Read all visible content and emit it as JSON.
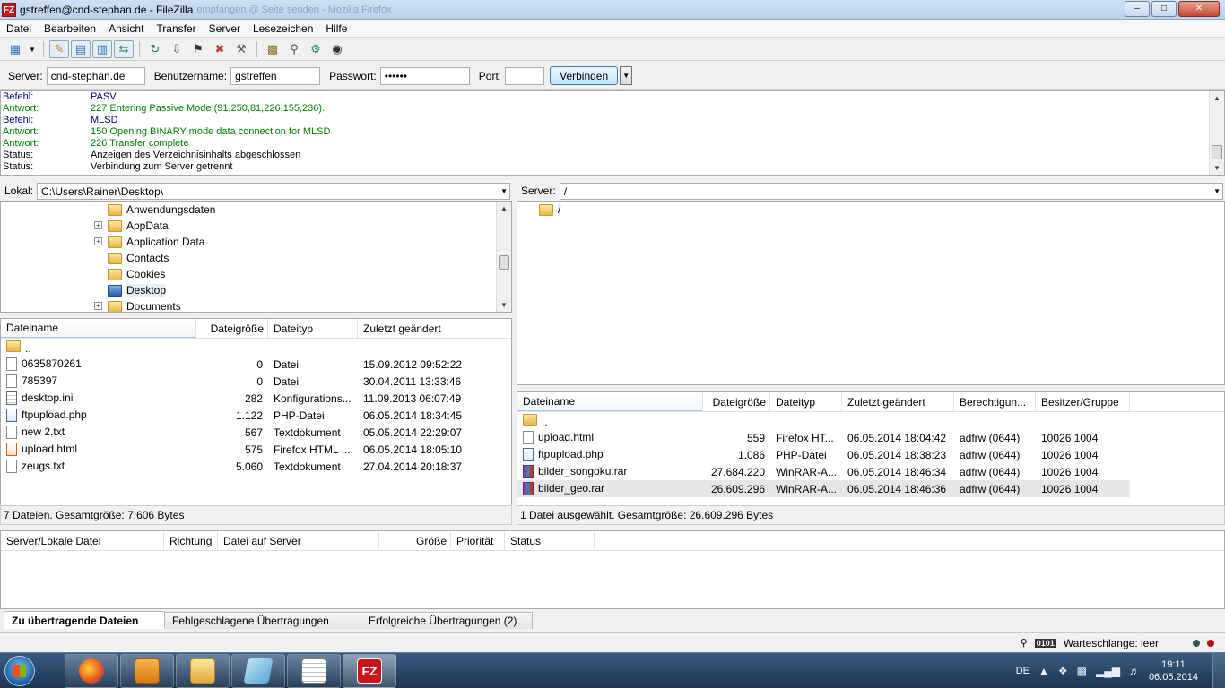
{
  "window": {
    "title": "gstreffen@cnd-stephan.de - FileZilla",
    "ghost_title": "empfangen @ Seite senden - Mozilla Firefox",
    "app_icon": "FZ"
  },
  "menu": [
    "Datei",
    "Bearbeiten",
    "Ansicht",
    "Transfer",
    "Server",
    "Lesezeichen",
    "Hilfe"
  ],
  "quickconnect": {
    "server_label": "Server:",
    "server_value": "cnd-stephan.de",
    "user_label": "Benutzername:",
    "user_value": "gstreffen",
    "password_label": "Passwort:",
    "password_value": "••••••",
    "port_label": "Port:",
    "port_value": "",
    "connect_label": "Verbinden"
  },
  "log": [
    {
      "type": "Befehl:",
      "text": "PASV",
      "kind": "cmd"
    },
    {
      "type": "Antwort:",
      "text": "227 Entering Passive Mode (91,250,81,226,155,236).",
      "kind": "resp"
    },
    {
      "type": "Befehl:",
      "text": "MLSD",
      "kind": "cmd"
    },
    {
      "type": "Antwort:",
      "text": "150 Opening BINARY mode data connection for MLSD",
      "kind": "resp"
    },
    {
      "type": "Antwort:",
      "text": "226 Transfer complete",
      "kind": "resp"
    },
    {
      "type": "Status:",
      "text": "Anzeigen des Verzeichnisinhalts abgeschlossen",
      "kind": "status"
    },
    {
      "type": "Status:",
      "text": "Verbindung zum Server getrennt",
      "kind": "status"
    }
  ],
  "local": {
    "path_label": "Lokal:",
    "path_value": "C:\\Users\\Rainer\\Desktop\\",
    "tree": [
      {
        "label": "Anwendungsdaten",
        "expandable": false,
        "icon": "folder-icon"
      },
      {
        "label": "AppData",
        "expandable": true,
        "icon": "folder-icon"
      },
      {
        "label": "Application Data",
        "expandable": true,
        "icon": "folder-icon"
      },
      {
        "label": "Contacts",
        "expandable": false,
        "icon": "contacts-folder-icon"
      },
      {
        "label": "Cookies",
        "expandable": false,
        "icon": "folder-icon"
      },
      {
        "label": "Desktop",
        "expandable": false,
        "icon": "desktop-folder-icon",
        "selected": true
      },
      {
        "label": "Documents",
        "expandable": true,
        "icon": "documents-folder-icon"
      }
    ],
    "columns": [
      "Dateiname",
      "Dateigröße",
      "Dateityp",
      "Zuletzt geändert"
    ],
    "files": [
      {
        "name": "..",
        "size": "",
        "type": "",
        "modified": "",
        "icon": "folder-icon"
      },
      {
        "name": "0635870261",
        "size": "0",
        "type": "Datei",
        "modified": "15.09.2012 09:52:22",
        "icon": "file-icon"
      },
      {
        "name": "785397",
        "size": "0",
        "type": "Datei",
        "modified": "30.04.2011 13:33:46",
        "icon": "file-icon"
      },
      {
        "name": "desktop.ini",
        "size": "282",
        "type": "Konfigurations...",
        "modified": "11.09.2013 06:07:49",
        "icon": "ini-file-icon"
      },
      {
        "name": "ftpupload.php",
        "size": "1.122",
        "type": "PHP-Datei",
        "modified": "06.05.2014 18:34:45",
        "icon": "php-file-icon"
      },
      {
        "name": "new  2.txt",
        "size": "567",
        "type": "Textdokument",
        "modified": "05.05.2014 22:29:07",
        "icon": "text-file-icon"
      },
      {
        "name": "upload.html",
        "size": "575",
        "type": "Firefox HTML ...",
        "modified": "06.05.2014 18:05:10",
        "icon": "html-file-icon"
      },
      {
        "name": "zeugs.txt",
        "size": "5.060",
        "type": "Textdokument",
        "modified": "27.04.2014 20:18:37",
        "icon": "text-file-icon"
      }
    ],
    "status": "7 Dateien. Gesamtgröße: 7.606 Bytes"
  },
  "remote": {
    "path_label": "Server:",
    "path_value": "/",
    "tree_root": "/",
    "columns": [
      "Dateiname",
      "Dateigröße",
      "Dateityp",
      "Zuletzt geändert",
      "Berechtigun...",
      "Besitzer/Gruppe"
    ],
    "files": [
      {
        "name": "..",
        "size": "",
        "type": "",
        "modified": "",
        "perm": "",
        "owner": "",
        "icon": "folder-icon"
      },
      {
        "name": "upload.html",
        "size": "559",
        "type": "Firefox HT...",
        "modified": "06.05.2014 18:04:42",
        "perm": "adfrw (0644)",
        "owner": "10026 1004",
        "icon": "file-icon"
      },
      {
        "name": "ftpupload.php",
        "size": "1.086",
        "type": "PHP-Datei",
        "modified": "06.05.2014 18:38:23",
        "perm": "adfrw (0644)",
        "owner": "10026 1004",
        "icon": "php-file-icon"
      },
      {
        "name": "bilder_songoku.rar",
        "size": "27.684.220",
        "type": "WinRAR-A...",
        "modified": "06.05.2014 18:46:34",
        "perm": "adfrw (0644)",
        "owner": "10026 1004",
        "icon": "rar-file-icon"
      },
      {
        "name": "bilder_geo.rar",
        "size": "26.609.296",
        "type": "WinRAR-A...",
        "modified": "06.05.2014 18:46:36",
        "perm": "adfrw (0644)",
        "owner": "10026 1004",
        "icon": "rar-file-icon",
        "selected": true
      }
    ],
    "status": "1 Datei ausgewählt. Gesamtgröße: 26.609.296 Bytes"
  },
  "queue": {
    "columns": [
      "Server/Lokale Datei",
      "Richtung",
      "Datei auf Server",
      "Größe",
      "Priorität",
      "Status"
    ],
    "tabs": [
      "Zu übertragende Dateien",
      "Fehlgeschlagene Übertragungen",
      "Erfolgreiche Übertragungen (2)"
    ]
  },
  "statusbar": {
    "queue_text": "Warteschlange: leer"
  },
  "taskbar": {
    "apps": [
      "firefox-icon",
      "outlook-icon",
      "explorer-icon",
      "notepad-icon",
      "editor-icon",
      "filezilla-icon"
    ],
    "language": "DE",
    "time": "19:11",
    "date": "06.05.2014"
  }
}
